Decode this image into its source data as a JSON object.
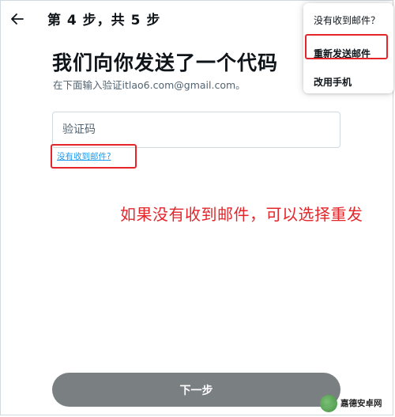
{
  "header": {
    "back_icon": "arrow-left-icon",
    "step_title": "第 4 步，共 5 步"
  },
  "main": {
    "title": "我们向你发送了一个代码",
    "subtitle": "在下面输入验证itlao6.com@gmail.com。",
    "code_input": {
      "placeholder": "验证码",
      "value": ""
    },
    "not_received_link": "没有收到邮件?"
  },
  "dropdown_menu": {
    "header": "没有收到邮件？",
    "items": [
      {
        "label": "重新发送邮件"
      },
      {
        "label": "改用手机"
      }
    ]
  },
  "annotation": "如果没有收到邮件，可以选择重发",
  "next_button": {
    "label": "下一步"
  },
  "watermark": {
    "text": "嘉德安卓网"
  },
  "colors": {
    "highlight": "#e4262b",
    "link": "#1d9bf0",
    "button_bg": "#7a7f82",
    "text": "#0f1419",
    "muted": "#536471"
  }
}
